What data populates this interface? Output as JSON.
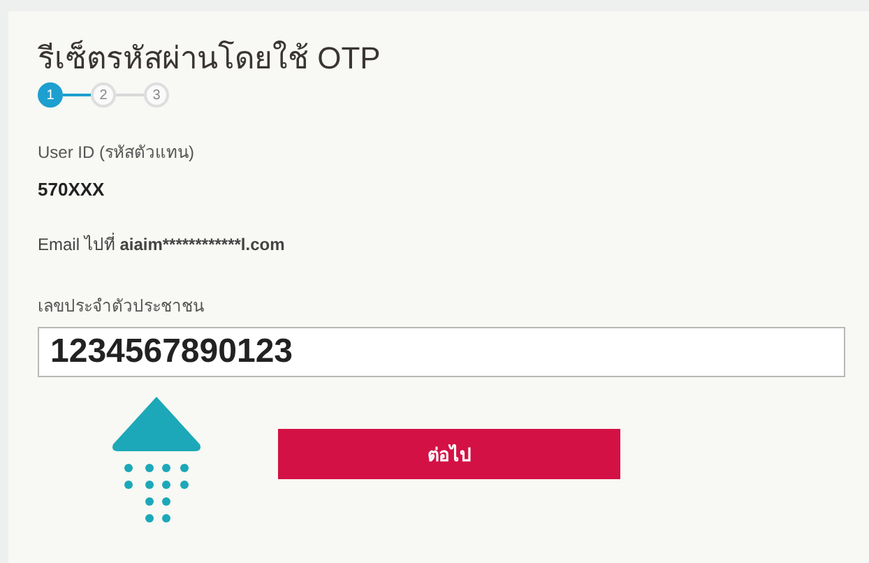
{
  "title": "รีเซ็ตรหัสผ่านโดยใช้ OTP",
  "steps": [
    {
      "label": "1",
      "selected": true
    },
    {
      "label": "2",
      "selected": false
    },
    {
      "label": "3",
      "selected": false
    }
  ],
  "user_id": {
    "label": "User ID (รหัสตัวแทน)",
    "value": "570XXX"
  },
  "email_note": {
    "prefix": "Email ไปที่",
    "address": "aiaim************l.com"
  },
  "id_field": {
    "label": "เลขประจำตัวประชาชน",
    "value": "1234567890123"
  },
  "next_button": "ต่อไป"
}
